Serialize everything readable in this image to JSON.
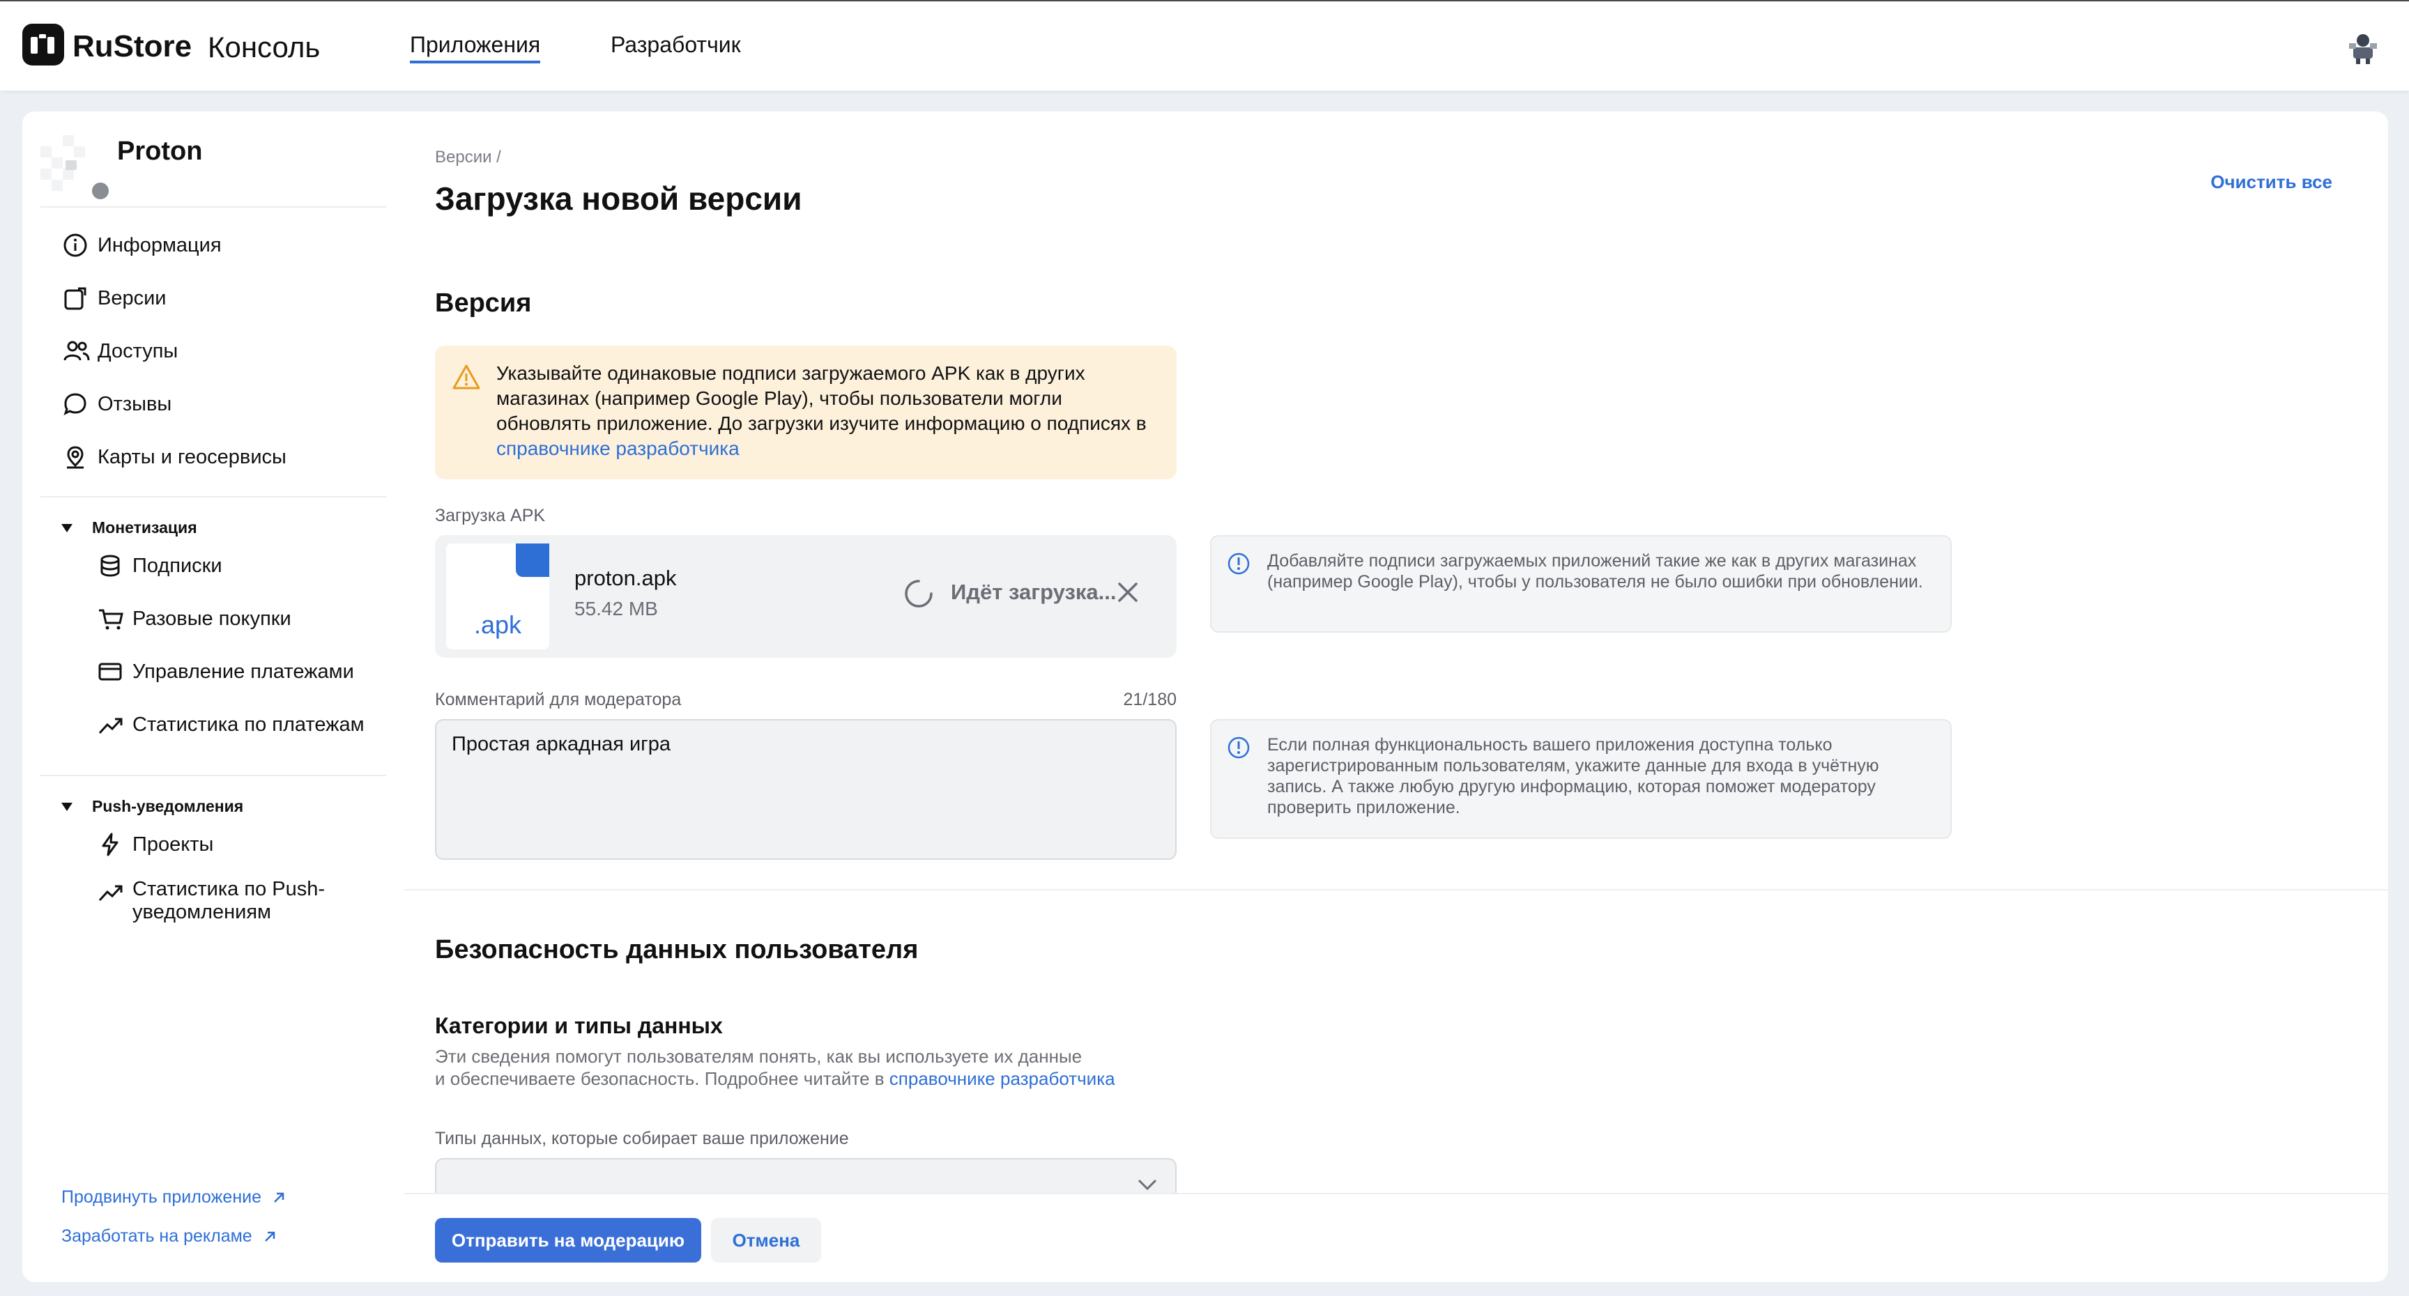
{
  "header": {
    "logo": "RuStore",
    "console": "Консоль",
    "tabs": [
      {
        "label": "Приложения",
        "active": true
      },
      {
        "label": "Разработчик",
        "active": false
      }
    ]
  },
  "sidebar": {
    "app_name": "Proton",
    "items": [
      {
        "label": "Информация",
        "icon": "info-icon"
      },
      {
        "label": "Версии",
        "icon": "versions-icon"
      },
      {
        "label": "Доступы",
        "icon": "users-icon"
      },
      {
        "label": "Отзывы",
        "icon": "chat-icon"
      },
      {
        "label": "Карты и геосервисы",
        "icon": "map-pin-icon"
      }
    ],
    "groups": [
      {
        "label": "Монетизация",
        "items": [
          {
            "label": "Подписки",
            "icon": "database-icon"
          },
          {
            "label": "Разовые покупки",
            "icon": "cart-icon"
          },
          {
            "label": "Управление платежами",
            "icon": "card-icon"
          },
          {
            "label": "Статистика по платежам",
            "icon": "trend-icon"
          }
        ]
      },
      {
        "label": "Push-уведомления",
        "items": [
          {
            "label": "Проекты",
            "icon": "lightning-icon"
          },
          {
            "label_line1": "Статистика по Push-",
            "label_line2": "уведомлениям",
            "icon": "trend-icon"
          }
        ]
      }
    ],
    "links": [
      {
        "label": "Продвинуть приложение"
      },
      {
        "label": "Заработать на рекламе"
      }
    ]
  },
  "main": {
    "breadcrumb": "Версии   /",
    "title": "Загрузка новой версии",
    "clear_all": "Очистить все",
    "version_section": "Версия",
    "warning": {
      "text": "Указывайте одинаковые подписи загружаемого APK как в других магазинах (например Google Play), чтобы пользователи могли обновлять приложение. До загрузки изучите информацию о подписях в ",
      "link": "справочнике разработчика"
    },
    "apk_label": "Загрузка APK",
    "upload": {
      "ext": ".apk",
      "file_name": "proton.apk",
      "file_size": "55.42 MB",
      "status": "Идёт загрузка..."
    },
    "info1": "Добавляйте подписи загружаемых приложений такие же как в других магазинах (например Google Play), чтобы у пользователя не было ошибки при обновлении.",
    "comment_label": "Комментарий для модератора",
    "comment_counter": "21/180",
    "comment_value": "Простая аркадная игра",
    "info2": "Если полная функциональность вашего приложения доступна только зарегистрированным пользователям, укажите данные для входа в учётную запись. А также любую другую информацию, которая поможет модератору проверить приложение.",
    "security_title": "Безопасность данных пользователя",
    "categories_title": "Категории и типы данных",
    "categories_desc_line1": "Эти сведения помогут пользователям понять, как вы используете их данные",
    "categories_desc_line2": "и обеспечиваете безопасность. Подробнее читайте в ",
    "categories_desc_link": "справочнике разработчика",
    "data_types_label": "Типы данных, которые собирает ваше приложение",
    "buttons": {
      "submit": "Отправить на модерацию",
      "cancel": "Отмена"
    }
  },
  "colors": {
    "accent": "#2e6fd6",
    "warning_bg": "#fdf1dc",
    "warning_icon": "#e89b1c"
  }
}
